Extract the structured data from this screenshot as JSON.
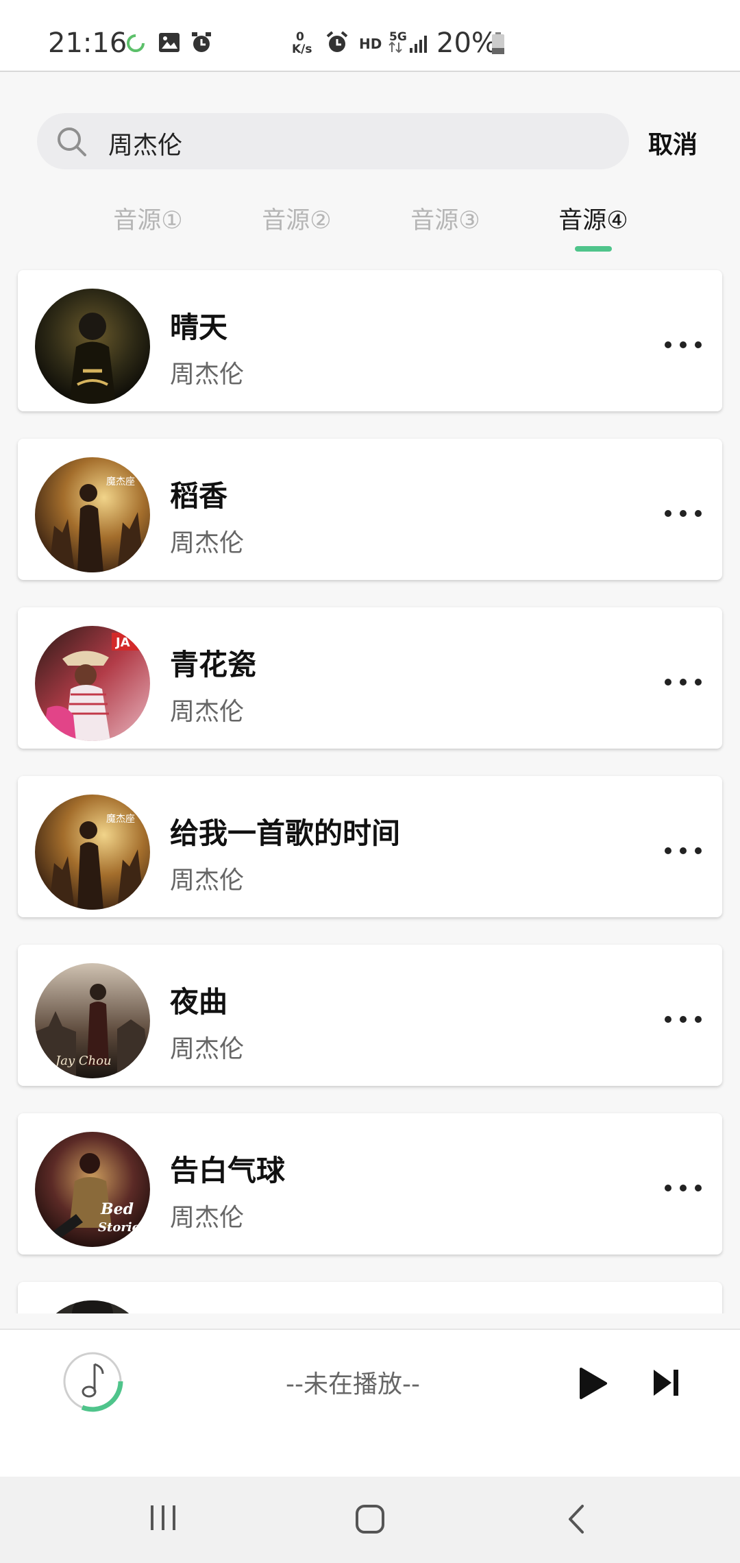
{
  "status_bar": {
    "time": "21:16",
    "net_speed_top": "0",
    "net_speed_bottom": "K/s",
    "hd": "HD",
    "network": "5G",
    "battery_pct": "20%"
  },
  "search": {
    "query": "周杰伦",
    "cancel_label": "取消"
  },
  "tabs": [
    {
      "label": "音源①",
      "active": false
    },
    {
      "label": "音源②",
      "active": false
    },
    {
      "label": "音源③",
      "active": false
    },
    {
      "label": "音源④",
      "active": true
    }
  ],
  "songs": [
    {
      "title": "晴天",
      "artist": "周杰伦",
      "cover": "album-cover-1"
    },
    {
      "title": "稻香",
      "artist": "周杰伦",
      "cover": "album-cover-2"
    },
    {
      "title": "青花瓷",
      "artist": "周杰伦",
      "cover": "album-cover-3"
    },
    {
      "title": "给我一首歌的时间",
      "artist": "周杰伦",
      "cover": "album-cover-2"
    },
    {
      "title": "夜曲",
      "artist": "周杰伦",
      "cover": "album-cover-4"
    },
    {
      "title": "告白气球",
      "artist": "周杰伦",
      "cover": "album-cover-5"
    },
    {
      "title": "",
      "artist": "",
      "cover": "album-cover-6"
    }
  ],
  "player": {
    "status": "--未在播放--"
  },
  "colors": {
    "accent": "#4fc48b",
    "background": "#f7f7f7"
  },
  "icons": [
    "search-icon",
    "more-icon",
    "music-note-icon",
    "play-icon",
    "skip-next-icon",
    "recents-icon",
    "home-icon",
    "back-icon"
  ]
}
